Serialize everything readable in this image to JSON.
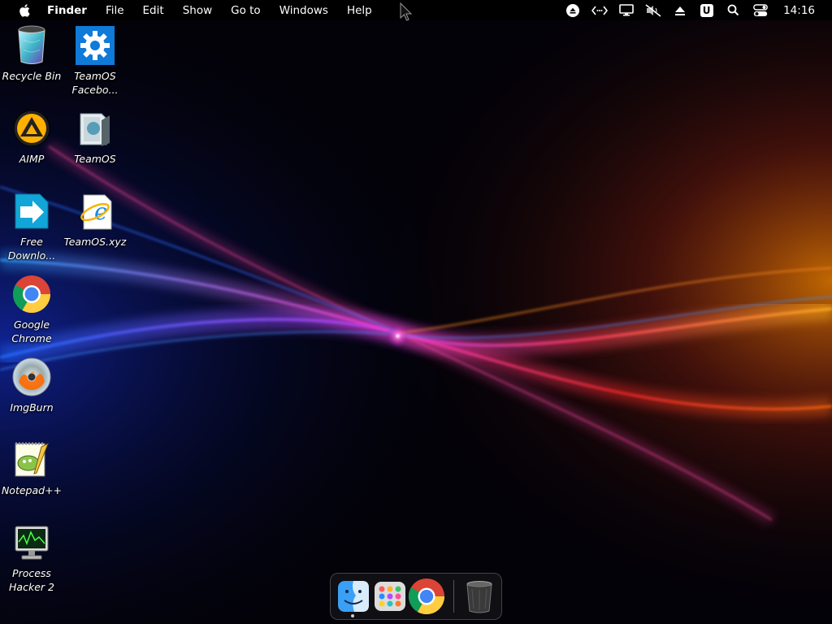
{
  "menubar": {
    "app_name": "Finder",
    "items": [
      "File",
      "Edit",
      "Show",
      "Go to",
      "Windows",
      "Help"
    ],
    "clock": "14:16",
    "status_icons": [
      "eject-icon",
      "code-icon",
      "display-icon",
      "mute-icon",
      "upload-icon",
      "u-badge-icon",
      "search-icon",
      "control-center-icon"
    ],
    "u_badge": "U"
  },
  "desktop": {
    "icons": [
      {
        "label": "Recycle Bin",
        "icon": "recycle-bin-icon"
      },
      {
        "label": "TeamOS\nFacebo...",
        "icon": "gear-icon"
      },
      {
        "label": "AIMP",
        "icon": "aimp-icon"
      },
      {
        "label": "TeamOS",
        "icon": "folder-icon"
      },
      {
        "label": "Free\nDownlo...",
        "icon": "download-arrow-icon"
      },
      {
        "label": "TeamOS.xyz",
        "icon": "internet-explorer-icon"
      },
      {
        "label": "Google\nChrome",
        "icon": "chrome-icon"
      },
      {
        "label": "ImgBurn",
        "icon": "disc-icon"
      },
      {
        "label": "Notepad++",
        "icon": "notepad-icon"
      },
      {
        "label": "Process\nHacker 2",
        "icon": "monitor-icon"
      }
    ]
  },
  "dock": {
    "items": [
      "finder-icon",
      "launchpad-icon",
      "chrome-icon",
      "trash-icon"
    ]
  },
  "colors": {
    "menubar_bg": "#000000",
    "wallpaper_bg": "#030208",
    "accent_blue": "#2a7bff",
    "accent_orange": "#ff9a1a",
    "accent_pink": "#ff44cc"
  }
}
